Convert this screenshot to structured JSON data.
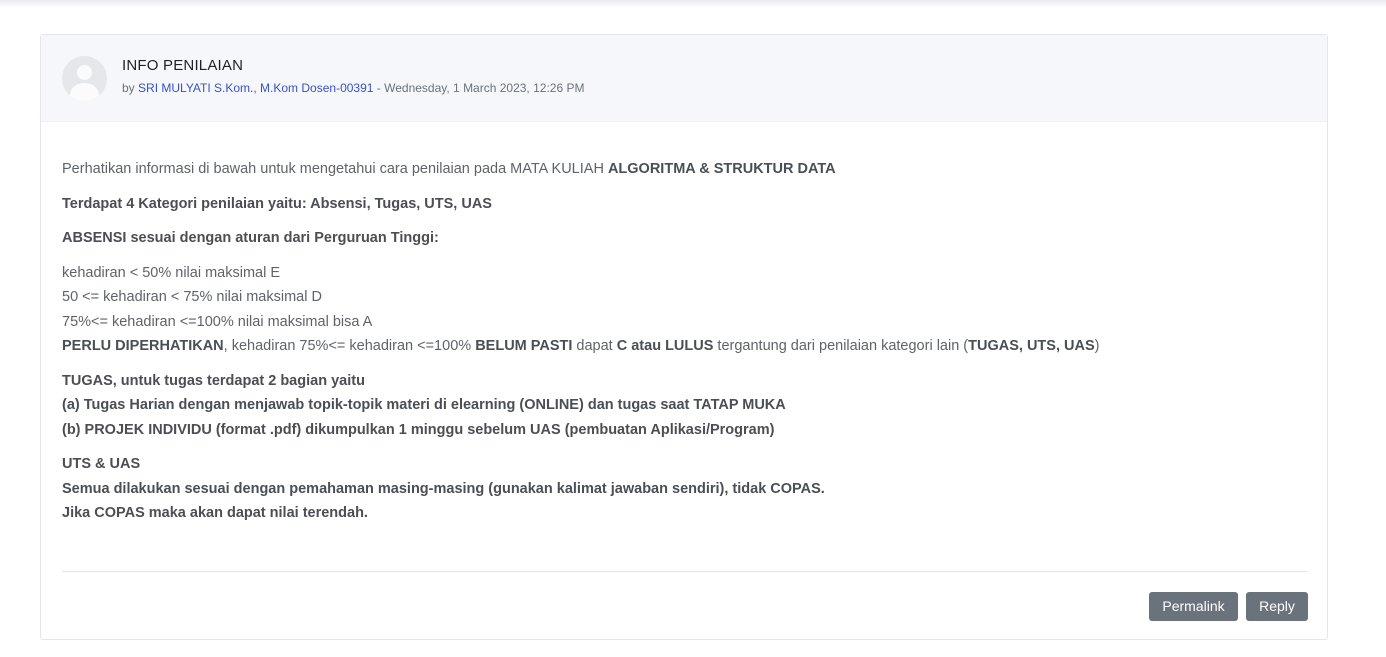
{
  "post": {
    "subject": "INFO PENILAIAN",
    "by_prefix": "by",
    "author": "SRI MULYATI S.Kom., M.Kom Dosen-00391",
    "date_sep": " - ",
    "date": "Wednesday, 1 March 2023, 12:26 PM"
  },
  "content": {
    "intro_text": "Perhatikan informasi di bawah untuk mengetahui cara penilaian pada MATA KULIAH ",
    "intro_bold": "ALGORITMA & STRUKTUR DATA",
    "categories": "Terdapat 4 Kategori penilaian yaitu: Absensi, Tugas, UTS, UAS",
    "absensi_heading": "ABSENSI sesuai dengan aturan dari Perguruan Tinggi:",
    "abs_line1": "kehadiran < 50% nilai maksimal E",
    "abs_line2": "50 <= kehadiran < 75% nilai maksimal D",
    "abs_line3": "75%<= kehadiran <=100% nilai maksimal bisa A",
    "perlu_b1": "PERLU DIPERHATIKAN",
    "perlu_t1": ", kehadiran 75%<= kehadiran <=100% ",
    "perlu_b2": "BELUM PASTI",
    "perlu_t2": " dapat ",
    "perlu_b3": "C atau LULUS",
    "perlu_t3": " tergantung dari penilaian kategori lain (",
    "perlu_b4": "TUGAS, UTS, UAS",
    "perlu_t4": ")",
    "tugas_heading": "TUGAS, untuk tugas terdapat 2 bagian yaitu",
    "tugas_a": "(a) Tugas Harian dengan menjawab topik-topik materi di elearning (ONLINE) dan tugas saat TATAP MUKA",
    "tugas_b": "(b) PROJEK INDIVIDU (format .pdf) dikumpulkan 1 minggu sebelum UAS (pembuatan Aplikasi/Program)",
    "uts_heading": "UTS & UAS",
    "uts_line1": "Semua dilakukan sesuai dengan pemahaman masing-masing (gunakan kalimat jawaban sendiri), tidak COPAS.",
    "uts_line2": "Jika COPAS maka akan dapat nilai terendah."
  },
  "actions": {
    "permalink_label": "Permalink",
    "reply_label": "Reply"
  },
  "colors": {
    "button_bg": "#6a737b",
    "link": "#3553c7",
    "header_bg": "#f6f7fa"
  }
}
